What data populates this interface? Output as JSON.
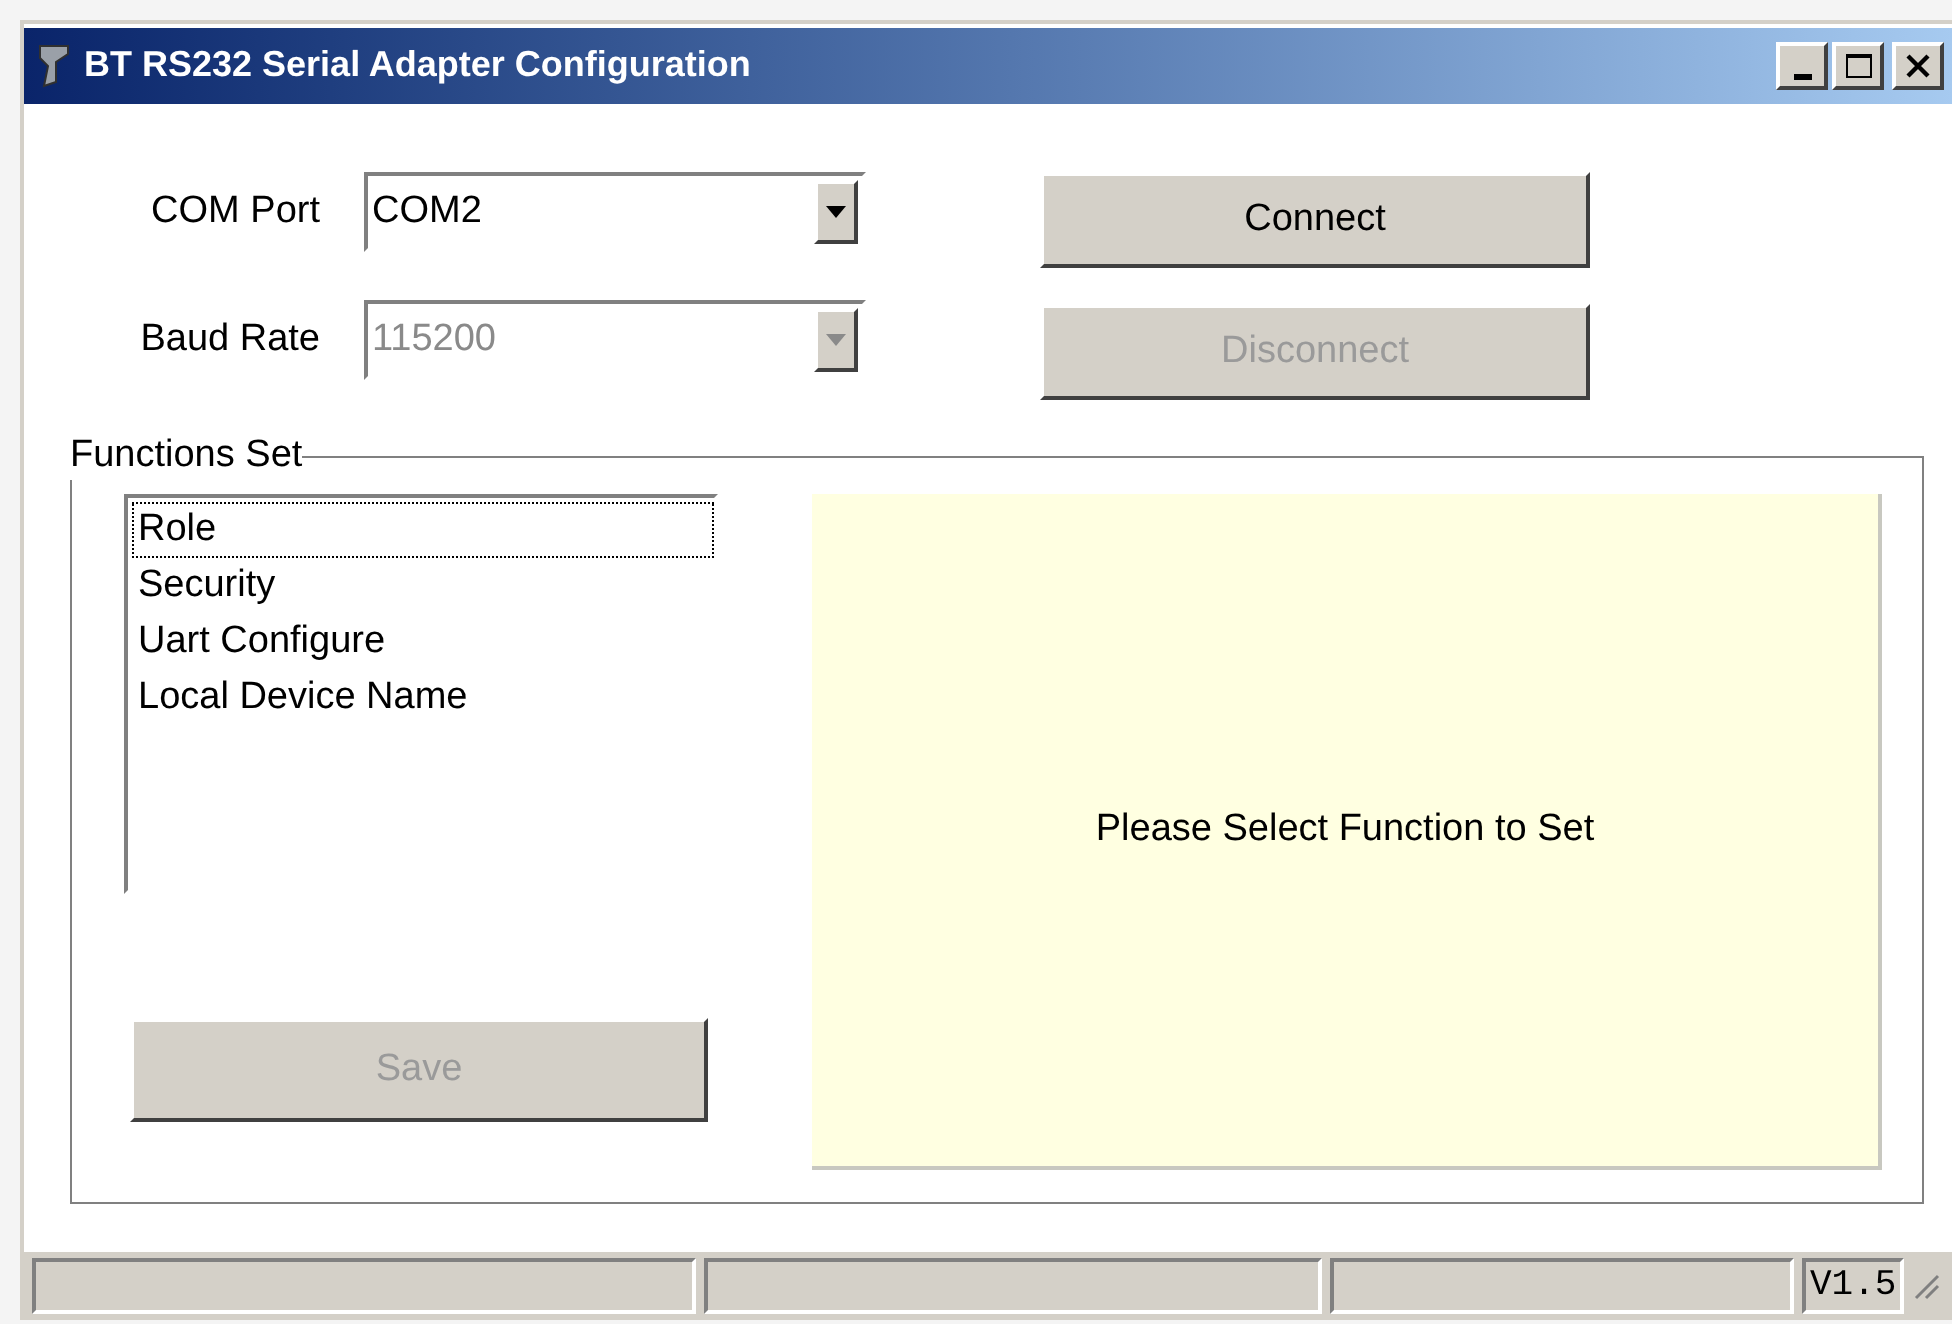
{
  "window": {
    "title": "BT RS232 Serial Adapter Configuration"
  },
  "fields": [
    {
      "label": "COM Port",
      "value": "COM2",
      "disabled": false
    },
    {
      "label": "Baud Rate",
      "value": "115200",
      "disabled": true
    }
  ],
  "buttons": [
    {
      "label": "Connect",
      "disabled": false
    },
    {
      "label": "Disconnect",
      "disabled": true
    }
  ],
  "functions_set": {
    "title": "Functions Set",
    "list": [
      {
        "label": "Role",
        "focused": true
      },
      {
        "label": "Security",
        "focused": false
      },
      {
        "label": "Uart Configure",
        "focused": false
      },
      {
        "label": "Local Device Name",
        "focused": false
      }
    ],
    "save_button": {
      "label": "Save",
      "disabled": true
    },
    "info_panel": {
      "message": "Please Select Function to Set"
    }
  },
  "status_bar": {
    "version": "V1.5"
  }
}
